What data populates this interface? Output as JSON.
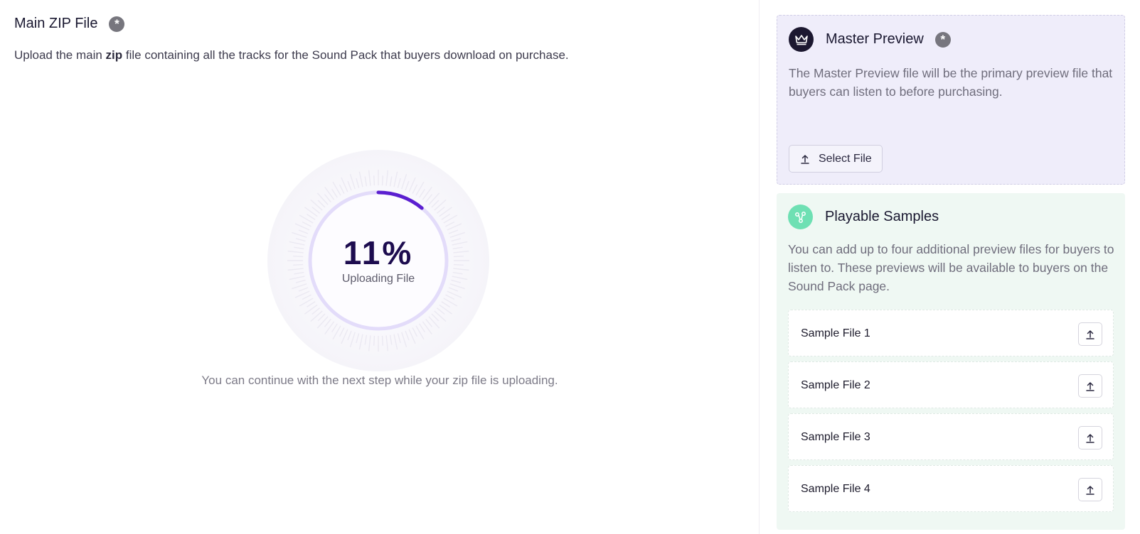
{
  "main_zip": {
    "title": "Main ZIP File",
    "required_icon": "asterisk-icon",
    "description_before": "Upload the main ",
    "description_bold": "zip",
    "description_after": " file containing all the tracks for the Sound Pack that buyers download on purchase.",
    "progress": {
      "percent": 11,
      "percent_label": "11%",
      "status": "Uploading File",
      "accent": "#5b1fd0"
    },
    "note": "You can continue with the next step while your zip file is uploading."
  },
  "master_preview": {
    "icon": "crown-icon",
    "title": "Master Preview",
    "required_icon": "asterisk-icon",
    "description": "The Master Preview file will be the primary preview file that buyers can listen to before purchasing.",
    "button_label": "Select File",
    "button_icon": "upload-icon",
    "background": "#efedfa"
  },
  "playable_samples": {
    "icon": "nodes-icon",
    "title": "Playable Samples",
    "description": "You can add up to four additional preview files for buyers to listen to. These previews will be available to buyers on the Sound Pack page.",
    "background": "#eff8f3",
    "items": [
      {
        "label": "Sample File 1",
        "action_icon": "upload-icon"
      },
      {
        "label": "Sample File 2",
        "action_icon": "upload-icon"
      },
      {
        "label": "Sample File 3",
        "action_icon": "upload-icon"
      },
      {
        "label": "Sample File 4",
        "action_icon": "upload-icon"
      }
    ]
  }
}
